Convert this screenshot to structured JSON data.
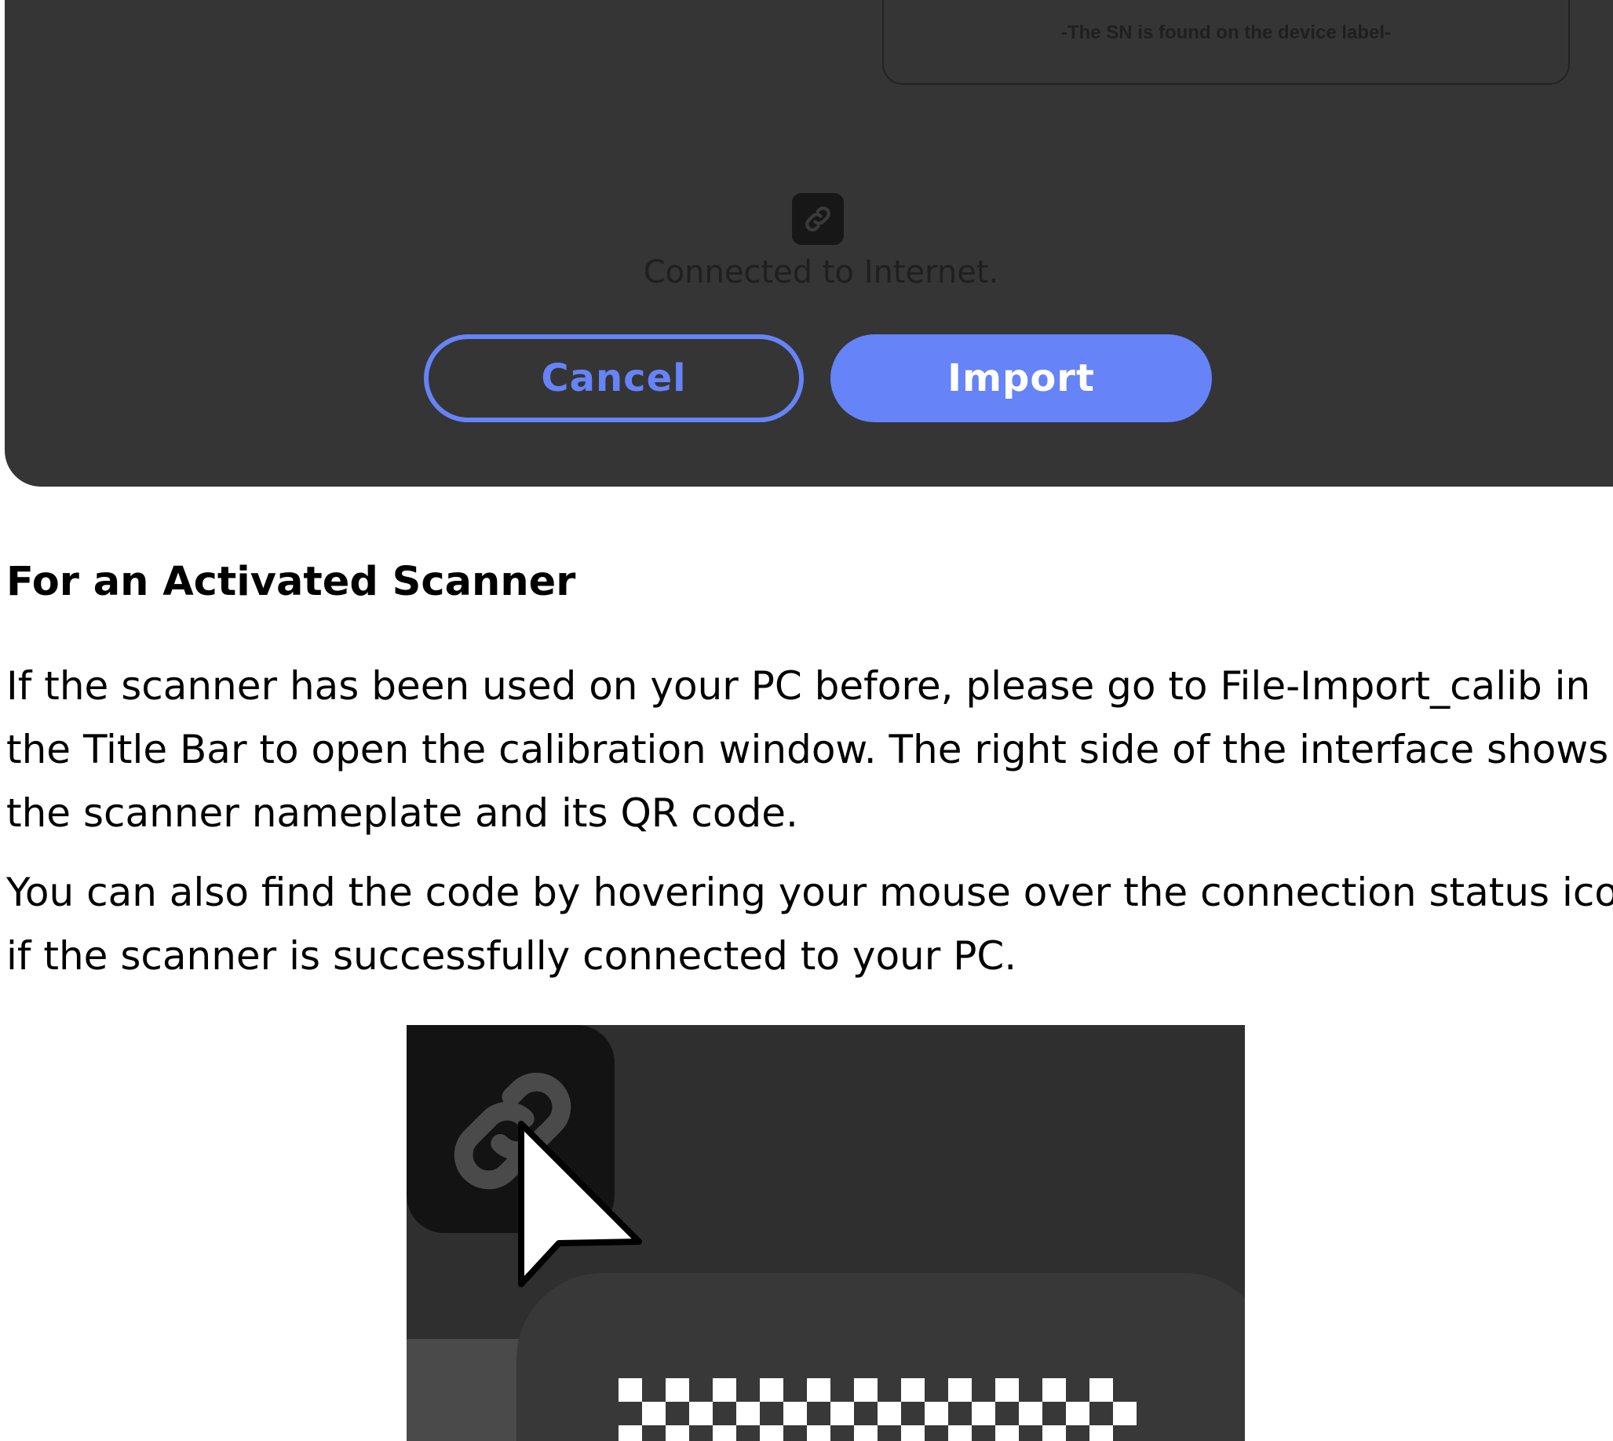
{
  "dialog": {
    "sn_note": "-The SN is found on the device label-",
    "connection_status": "Connected to Internet.",
    "cancel_label": "Cancel",
    "import_label": "Import",
    "accent_color": "#6683f7",
    "background_color": "#353535"
  },
  "article": {
    "heading": "For an Activated Scanner",
    "paragraph1_lines": [
      "If the scanner has been used on your PC before, please go to File-Import_calib in",
      "the Title Bar to open the calibration window. The right side of the interface shows",
      "the scanner nameplate and its QR code."
    ],
    "paragraph2_lines": [
      "You can also find the code by hovering your mouse over the connection status icon",
      "if the scanner is successfully connected to your PC."
    ]
  },
  "icons": {
    "status_icon": "link-icon",
    "pointer": "mouse-cursor-icon",
    "qr": "qr-code-icon"
  }
}
